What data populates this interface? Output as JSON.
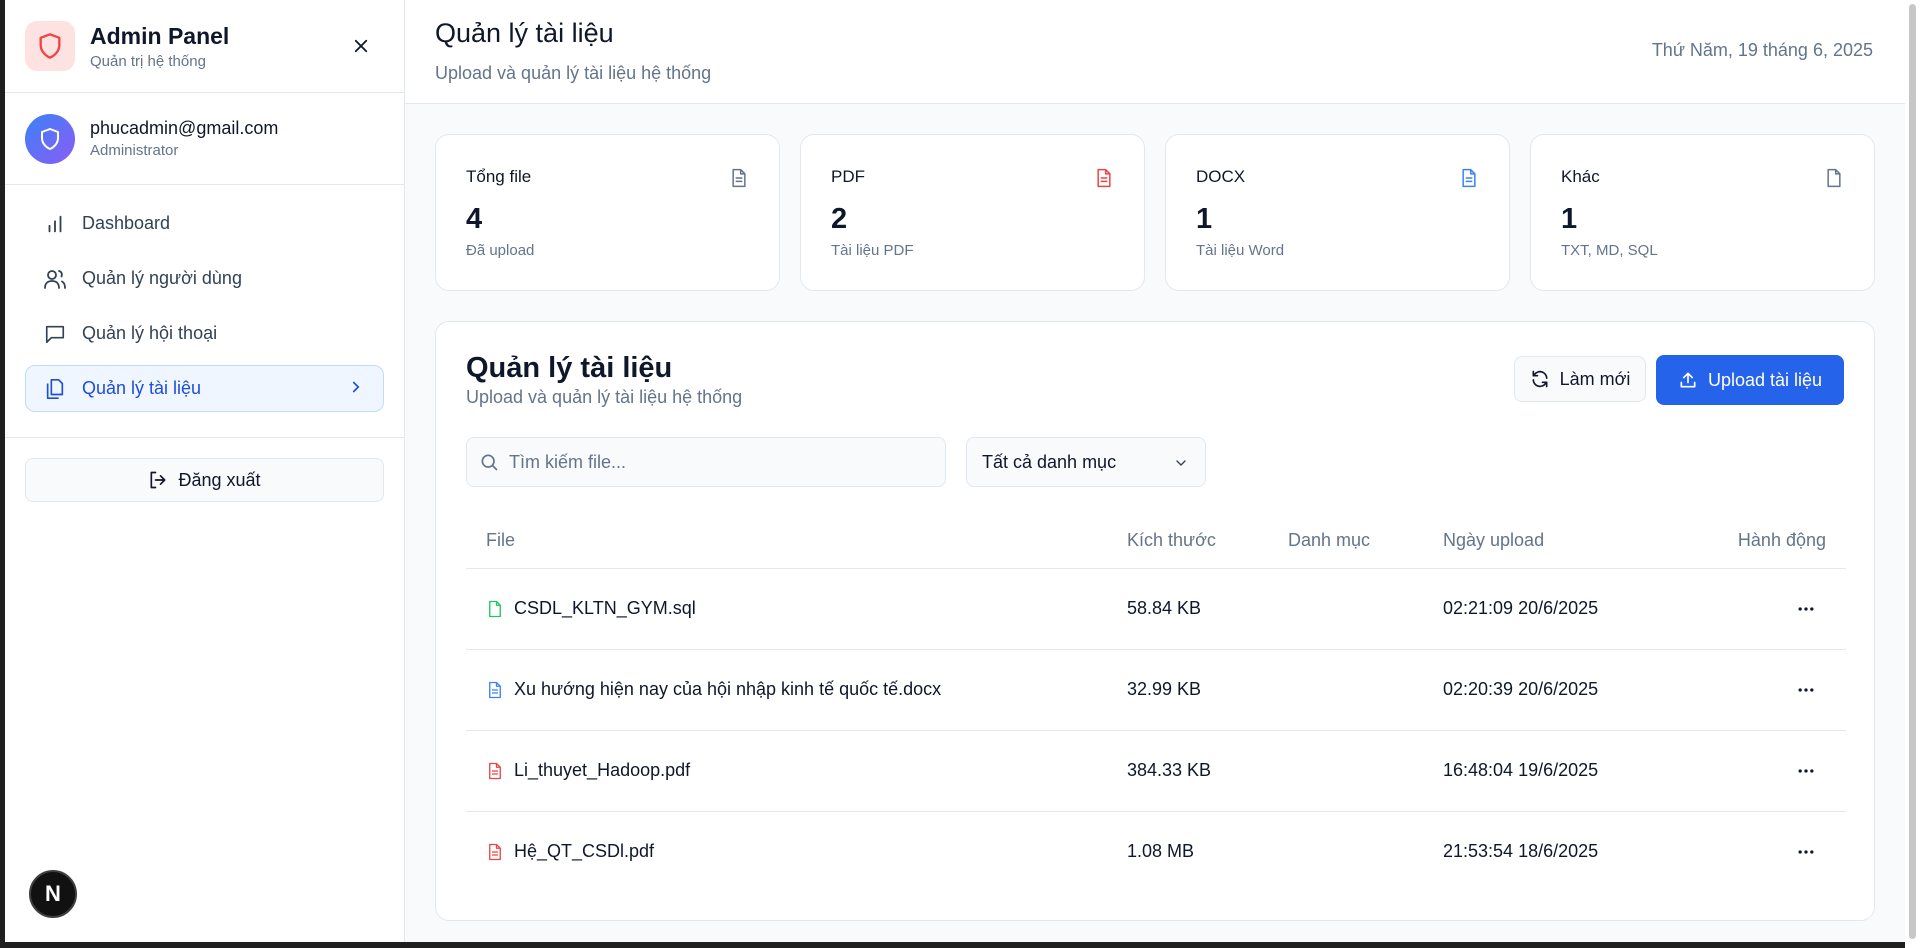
{
  "sidebar": {
    "brand_title": "Admin Panel",
    "brand_subtitle": "Quản trị hệ thống",
    "user_email": "phucadmin@gmail.com",
    "user_role": "Administrator",
    "nav": [
      {
        "label": "Dashboard",
        "icon": "bar-chart-icon"
      },
      {
        "label": "Quản lý người dùng",
        "icon": "users-icon"
      },
      {
        "label": "Quản lý hội thoại",
        "icon": "message-icon"
      },
      {
        "label": "Quản lý tài liệu",
        "icon": "files-icon",
        "active": true
      }
    ],
    "logout_label": "Đăng xuất",
    "badge_letter": "N"
  },
  "header": {
    "title": "Quản lý tài liệu",
    "subtitle": "Upload và quản lý tài liệu hệ thống",
    "date": "Thứ Năm, 19 tháng 6, 2025"
  },
  "stats": [
    {
      "label": "Tổng file",
      "value": "4",
      "desc": "Đã upload",
      "color": "#64748b"
    },
    {
      "label": "PDF",
      "value": "2",
      "desc": "Tài liệu PDF",
      "color": "#ef4444"
    },
    {
      "label": "DOCX",
      "value": "1",
      "desc": "Tài liệu Word",
      "color": "#3b82f6"
    },
    {
      "label": "Khác",
      "value": "1",
      "desc": "TXT, MD, SQL",
      "color": "#64748b"
    }
  ],
  "docs": {
    "title": "Quản lý tài liệu",
    "subtitle": "Upload và quản lý tài liệu hệ thống",
    "refresh_label": "Làm mới",
    "upload_label": "Upload tài liệu",
    "search_placeholder": "Tìm kiếm file...",
    "category_selected": "Tất cả danh mục",
    "columns": {
      "file": "File",
      "size": "Kích thước",
      "category": "Danh mục",
      "date": "Ngày upload",
      "action": "Hành động"
    },
    "rows": [
      {
        "name": "CSDL_KLTN_GYM.sql",
        "size": "58.84 KB",
        "category": "",
        "date": "02:21:09 20/6/2025",
        "color": "#22c55e"
      },
      {
        "name": "Xu hướng hiện nay của hội nhập kinh tế quốc tế.docx",
        "size": "32.99 KB",
        "category": "",
        "date": "02:20:39 20/6/2025",
        "color": "#3b82f6"
      },
      {
        "name": "Li_thuyet_Hadoop.pdf",
        "size": "384.33 KB",
        "category": "",
        "date": "16:48:04 19/6/2025",
        "color": "#ef4444"
      },
      {
        "name": "Hệ_QT_CSDl.pdf",
        "size": "1.08 MB",
        "category": "",
        "date": "21:53:54 18/6/2025",
        "color": "#ef4444"
      }
    ]
  },
  "colors": {
    "accent": "#2563eb",
    "active_bg": "#eff6ff",
    "logo_bg": "#fee2e2",
    "logo_fg": "#ef4444"
  }
}
